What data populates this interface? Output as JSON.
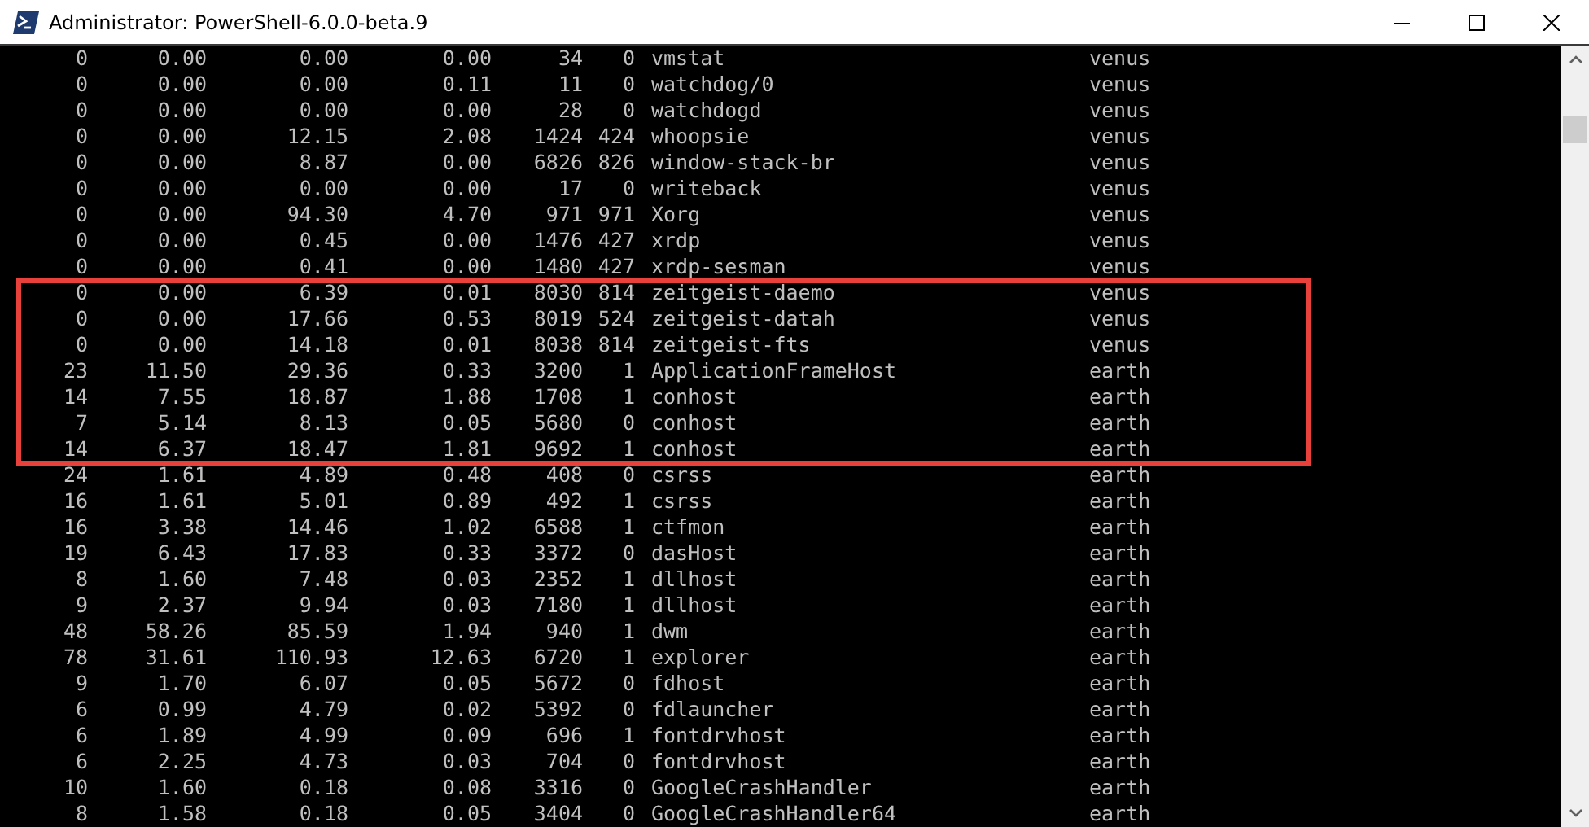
{
  "window": {
    "title": "Administrator: PowerShell-6.0.0-beta.9"
  },
  "console": {
    "rows": [
      {
        "cells": [
          "0",
          "0.00",
          "0.00",
          "0.00",
          "34",
          "0",
          "vmstat",
          "venus"
        ],
        "boxed": false
      },
      {
        "cells": [
          "0",
          "0.00",
          "0.00",
          "0.11",
          "11",
          "0",
          "watchdog/0",
          "venus"
        ],
        "boxed": false
      },
      {
        "cells": [
          "0",
          "0.00",
          "0.00",
          "0.00",
          "28",
          "0",
          "watchdogd",
          "venus"
        ],
        "boxed": false
      },
      {
        "cells": [
          "0",
          "0.00",
          "12.15",
          "2.08",
          "1424",
          "424",
          "whoopsie",
          "venus"
        ],
        "boxed": false
      },
      {
        "cells": [
          "0",
          "0.00",
          "8.87",
          "0.00",
          "6826",
          "826",
          "window-stack-br",
          "venus"
        ],
        "boxed": false
      },
      {
        "cells": [
          "0",
          "0.00",
          "0.00",
          "0.00",
          "17",
          "0",
          "writeback",
          "venus"
        ],
        "boxed": false
      },
      {
        "cells": [
          "0",
          "0.00",
          "94.30",
          "4.70",
          "971",
          "971",
          "Xorg",
          "venus"
        ],
        "boxed": false
      },
      {
        "cells": [
          "0",
          "0.00",
          "0.45",
          "0.00",
          "1476",
          "427",
          "xrdp",
          "venus"
        ],
        "boxed": false
      },
      {
        "cells": [
          "0",
          "0.00",
          "0.41",
          "0.00",
          "1480",
          "427",
          "xrdp-sesman",
          "venus"
        ],
        "boxed": false
      },
      {
        "cells": [
          "0",
          "0.00",
          "6.39",
          "0.01",
          "8030",
          "814",
          "zeitgeist-daemo",
          "venus"
        ],
        "boxed": true
      },
      {
        "cells": [
          "0",
          "0.00",
          "17.66",
          "0.53",
          "8019",
          "524",
          "zeitgeist-datah",
          "venus"
        ],
        "boxed": true
      },
      {
        "cells": [
          "0",
          "0.00",
          "14.18",
          "0.01",
          "8038",
          "814",
          "zeitgeist-fts",
          "venus"
        ],
        "boxed": true
      },
      {
        "cells": [
          "23",
          "11.50",
          "29.36",
          "0.33",
          "3200",
          "1",
          "ApplicationFrameHost",
          "earth"
        ],
        "boxed": true
      },
      {
        "cells": [
          "14",
          "7.55",
          "18.87",
          "1.88",
          "1708",
          "1",
          "conhost",
          "earth"
        ],
        "boxed": true
      },
      {
        "cells": [
          "7",
          "5.14",
          "8.13",
          "0.05",
          "5680",
          "0",
          "conhost",
          "earth"
        ],
        "boxed": true
      },
      {
        "cells": [
          "14",
          "6.37",
          "18.47",
          "1.81",
          "9692",
          "1",
          "conhost",
          "earth"
        ],
        "boxed": true
      },
      {
        "cells": [
          "24",
          "1.61",
          "4.89",
          "0.48",
          "408",
          "0",
          "csrss",
          "earth"
        ],
        "boxed": false
      },
      {
        "cells": [
          "16",
          "1.61",
          "5.01",
          "0.89",
          "492",
          "1",
          "csrss",
          "earth"
        ],
        "boxed": false
      },
      {
        "cells": [
          "16",
          "3.38",
          "14.46",
          "1.02",
          "6588",
          "1",
          "ctfmon",
          "earth"
        ],
        "boxed": false
      },
      {
        "cells": [
          "19",
          "6.43",
          "17.83",
          "0.33",
          "3372",
          "0",
          "dasHost",
          "earth"
        ],
        "boxed": false
      },
      {
        "cells": [
          "8",
          "1.60",
          "7.48",
          "0.03",
          "2352",
          "1",
          "dllhost",
          "earth"
        ],
        "boxed": false
      },
      {
        "cells": [
          "9",
          "2.37",
          "9.94",
          "0.03",
          "7180",
          "1",
          "dllhost",
          "earth"
        ],
        "boxed": false
      },
      {
        "cells": [
          "48",
          "58.26",
          "85.59",
          "1.94",
          "940",
          "1",
          "dwm",
          "earth"
        ],
        "boxed": false
      },
      {
        "cells": [
          "78",
          "31.61",
          "110.93",
          "12.63",
          "6720",
          "1",
          "explorer",
          "earth"
        ],
        "boxed": false
      },
      {
        "cells": [
          "9",
          "1.70",
          "6.07",
          "0.05",
          "5672",
          "0",
          "fdhost",
          "earth"
        ],
        "boxed": false
      },
      {
        "cells": [
          "6",
          "0.99",
          "4.79",
          "0.02",
          "5392",
          "0",
          "fdlauncher",
          "earth"
        ],
        "boxed": false
      },
      {
        "cells": [
          "6",
          "1.89",
          "4.99",
          "0.09",
          "696",
          "1",
          "fontdrvhost",
          "earth"
        ],
        "boxed": false
      },
      {
        "cells": [
          "6",
          "2.25",
          "4.73",
          "0.03",
          "704",
          "0",
          "fontdrvhost",
          "earth"
        ],
        "boxed": false
      },
      {
        "cells": [
          "10",
          "1.60",
          "0.18",
          "0.08",
          "3316",
          "0",
          "GoogleCrashHandler",
          "earth"
        ],
        "boxed": false
      },
      {
        "cells": [
          "8",
          "1.58",
          "0.18",
          "0.05",
          "3404",
          "0",
          "GoogleCrashHandler64",
          "earth"
        ],
        "boxed": false
      }
    ]
  }
}
